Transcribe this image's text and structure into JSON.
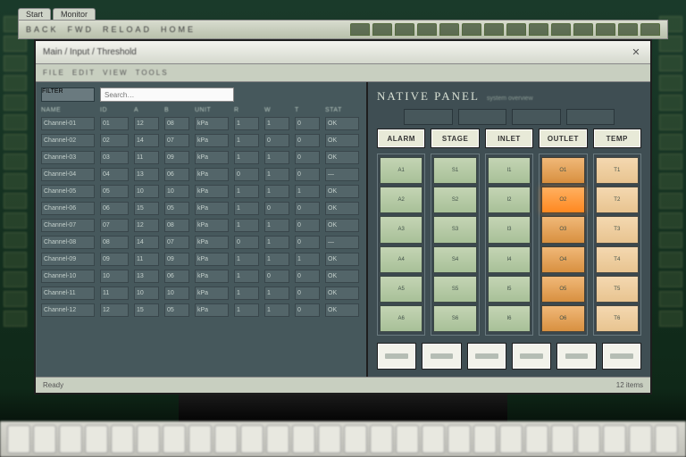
{
  "tabs": [
    {
      "label": "Start"
    },
    {
      "label": "Monitor"
    }
  ],
  "browser_strip": {
    "segments": [
      "BACK",
      "FWD",
      "RELOAD",
      "HOME"
    ],
    "right_tab_count": 14
  },
  "window": {
    "title": "Main / Input / Threshold",
    "close_glyph": "✕"
  },
  "toolbar": [
    "FILE",
    "EDIT",
    "VIEW",
    "TOOLS"
  ],
  "search": {
    "placeholder": "Search…",
    "filter_label": "FILTER"
  },
  "grid": {
    "headers": [
      "NAME",
      "ID",
      "A",
      "B",
      "UNIT",
      "R",
      "W",
      "T",
      "STAT"
    ],
    "rows": [
      [
        "Channel-01",
        "01",
        "12",
        "08",
        "kPa",
        "1",
        "1",
        "0",
        "OK"
      ],
      [
        "Channel-02",
        "02",
        "14",
        "07",
        "kPa",
        "1",
        "0",
        "0",
        "OK"
      ],
      [
        "Channel-03",
        "03",
        "11",
        "09",
        "kPa",
        "1",
        "1",
        "0",
        "OK"
      ],
      [
        "Channel-04",
        "04",
        "13",
        "06",
        "kPa",
        "0",
        "1",
        "0",
        "—"
      ],
      [
        "Channel-05",
        "05",
        "10",
        "10",
        "kPa",
        "1",
        "1",
        "1",
        "OK"
      ],
      [
        "Channel-06",
        "06",
        "15",
        "05",
        "kPa",
        "1",
        "0",
        "0",
        "OK"
      ],
      [
        "Channel-07",
        "07",
        "12",
        "08",
        "kPa",
        "1",
        "1",
        "0",
        "OK"
      ],
      [
        "Channel-08",
        "08",
        "14",
        "07",
        "kPa",
        "0",
        "1",
        "0",
        "—"
      ],
      [
        "Channel-09",
        "09",
        "11",
        "09",
        "kPa",
        "1",
        "1",
        "1",
        "OK"
      ],
      [
        "Channel-10",
        "10",
        "13",
        "06",
        "kPa",
        "1",
        "0",
        "0",
        "OK"
      ],
      [
        "Channel-11",
        "11",
        "10",
        "10",
        "kPa",
        "1",
        "1",
        "0",
        "OK"
      ],
      [
        "Channel-12",
        "12",
        "15",
        "05",
        "kPa",
        "1",
        "1",
        "0",
        "OK"
      ]
    ]
  },
  "statusbar": {
    "left": "Ready",
    "right": "12 items"
  },
  "panel": {
    "title": "NATIVE PANEL",
    "subtitle": "system overview",
    "tile_count": 4,
    "headers": [
      "ALARM",
      "STAGE",
      "INLET",
      "OUTLET",
      "TEMP"
    ],
    "columns": [
      {
        "tone": "green",
        "cells": [
          "A1",
          "A2",
          "A3",
          "A4",
          "A5",
          "A6"
        ]
      },
      {
        "tone": "green",
        "cells": [
          "S1",
          "S2",
          "S3",
          "S4",
          "S5",
          "S6"
        ]
      },
      {
        "tone": "green",
        "cells": [
          "I1",
          "I2",
          "I3",
          "I4",
          "I5",
          "I6"
        ]
      },
      {
        "tone": "orange",
        "cells": [
          "O1",
          "O2",
          "O3",
          "O4",
          "O5",
          "O6"
        ],
        "hot_index": 1
      },
      {
        "tone": "peach",
        "cells": [
          "T1",
          "T2",
          "T3",
          "T4",
          "T5",
          "T6"
        ]
      }
    ],
    "actions": [
      "—",
      "—",
      "—",
      "—",
      "—",
      "—"
    ]
  },
  "colors": {
    "bg": "#4a5a5f",
    "green": "#a8c098",
    "orange": "#d89040",
    "peach": "#e8c490"
  }
}
